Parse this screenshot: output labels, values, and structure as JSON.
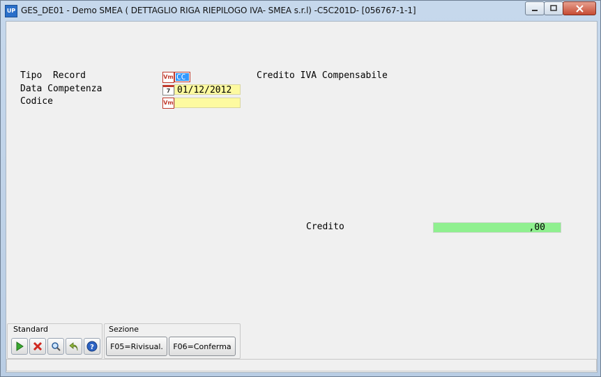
{
  "window": {
    "title": "GES_DE01 - Demo SMEA (  DETTAGLIO RIGA RIEPILOGO IVA- SMEA s.r.l) -C5C201D- [056767-1-1]",
    "app_icon_text": "UP"
  },
  "form": {
    "tipo_record_label": "Tipo  Record",
    "tipo_record_value": "CC",
    "tipo_record_description": "Credito IVA Compensabile",
    "data_competenza_label": "Data Competenza",
    "data_competenza_value": "01/12/2012",
    "codice_label": "Codice",
    "codice_value": "",
    "credito_label": "Credito",
    "credito_value": ",00"
  },
  "toolbar": {
    "standard_label": "Standard",
    "sezione_label": "Sezione",
    "f05_label": "F05=Rivisual.",
    "f06_label": "F06=Conferma"
  },
  "icons": {
    "field_lookup": "Vm",
    "calendar": "7"
  },
  "colors": {
    "input_bg": "#fdfaa0",
    "money_bg": "#8ff08f",
    "selection": "#3399ff"
  }
}
